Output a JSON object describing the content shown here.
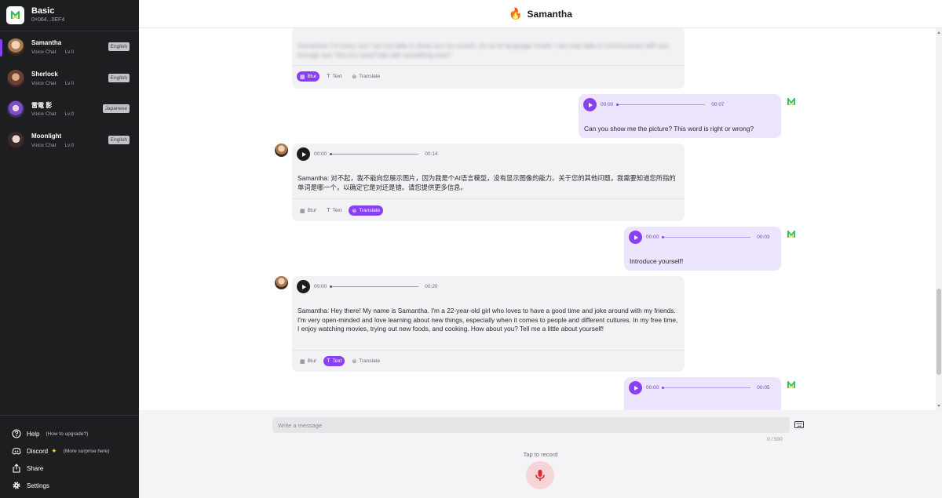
{
  "sidebar": {
    "brand_title": "Basic",
    "brand_id": "0×064...0EF4",
    "characters": [
      {
        "name": "Samantha",
        "mode": "Voice Chat",
        "level": "Lv.0",
        "language": "English"
      },
      {
        "name": "Sherlock",
        "mode": "Voice Chat",
        "level": "Lv.0",
        "language": "English"
      },
      {
        "name": "雷電 影",
        "mode": "Voice Chat",
        "level": "Lv.0",
        "language": "Japanese"
      },
      {
        "name": "Moonlight",
        "mode": "Voice Chat",
        "level": "Lv.0",
        "language": "English"
      }
    ],
    "links": {
      "help": "Help",
      "help_sub": "(How to upgrade?)",
      "discord": "Discord",
      "discord_sub": "(More surprise here)",
      "share": "Share",
      "settings": "Settings"
    }
  },
  "header": {
    "title": "Samantha",
    "icon": "fire-icon"
  },
  "actions": {
    "blur": "Blur",
    "text": "Text",
    "translate": "Translate"
  },
  "messages": [
    {
      "role": "bot",
      "text": "Samantha: I'm sorry, but I am not able to show you my screen. As an AI language model, I am only able to communicate with you through text. Did you need help with something else?",
      "mode": "Blur"
    },
    {
      "role": "user",
      "start": "00:00",
      "duration": "00:07",
      "text": "Can you show me the picture? This word is right or wrong?"
    },
    {
      "role": "bot",
      "start": "00:00",
      "duration": "00:14",
      "text": "Samantha: 对不起，我不能向您展示图片，因为我是个AI语言模型，没有显示图像的能力。关于您的其他问题，我需要知道您所指的单词是哪一个，以确定它是对还是错。请您提供更多信息。",
      "mode": "Translate"
    },
    {
      "role": "user",
      "start": "00:00",
      "duration": "00:03",
      "text": "Introduce yourself!"
    },
    {
      "role": "bot",
      "start": "00:00",
      "duration": "00:20",
      "text": "Samantha: Hey there! My name is Samantha. I'm a 22-year-old girl who loves to have a good time and joke around with my friends. I'm very open-minded and love learning about new things, especially when it comes to people and different cultures. In my free time, I enjoy watching movies, trying out new foods, and cooking. How about you? Tell me a little about yourself!",
      "mode": "Text"
    },
    {
      "role": "user",
      "start": "00:00",
      "duration": "00:05",
      "text": ""
    }
  ],
  "composer": {
    "placeholder": "Write a message",
    "counter": "0 / 500",
    "tap_label": "Tap to record"
  },
  "colors": {
    "accent": "#8a3ff5",
    "user_bubble": "#ede4fd",
    "bot_bubble": "#f2f2f4",
    "sidebar": "#1d1e20"
  }
}
